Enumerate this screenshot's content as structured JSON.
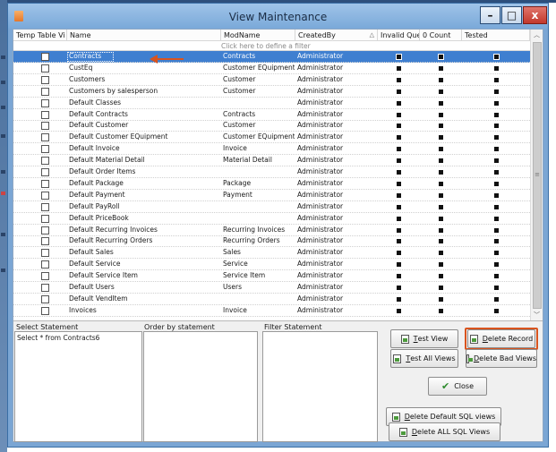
{
  "window": {
    "title": "View Maintenance",
    "min_label": "–",
    "max_label": "□",
    "close_label": "x"
  },
  "columns": [
    "Temp Table Vi",
    "Name",
    "ModName",
    "CreatedBy",
    "Invalid Quer",
    "0 Count",
    "Tested"
  ],
  "filter_prompt": "Click here to define a filter",
  "rows": [
    {
      "name": "Contracts",
      "mod": "Contracts",
      "by": "Administrator",
      "selected": true
    },
    {
      "name": "CustEq",
      "mod": "Customer EQuipment",
      "by": "Administrator"
    },
    {
      "name": "Customers",
      "mod": "Customer",
      "by": "Administrator"
    },
    {
      "name": "Customers by salesperson",
      "mod": "Customer",
      "by": "Administrator"
    },
    {
      "name": "Default Classes",
      "mod": "",
      "by": "Administrator"
    },
    {
      "name": "Default Contracts",
      "mod": "Contracts",
      "by": "Administrator"
    },
    {
      "name": "Default Customer",
      "mod": "Customer",
      "by": "Administrator"
    },
    {
      "name": "Default Customer EQuipment",
      "mod": "Customer EQuipment",
      "by": "Administrator"
    },
    {
      "name": "Default Invoice",
      "mod": "Invoice",
      "by": "Administrator"
    },
    {
      "name": "Default Material Detail",
      "mod": "Material Detail",
      "by": "Administrator"
    },
    {
      "name": "Default Order Items",
      "mod": "",
      "by": "Administrator"
    },
    {
      "name": "Default Package",
      "mod": "Package",
      "by": "Administrator"
    },
    {
      "name": "Default Payment",
      "mod": "Payment",
      "by": "Administrator"
    },
    {
      "name": "Default PayRoll",
      "mod": "",
      "by": "Administrator"
    },
    {
      "name": "Default PriceBook",
      "mod": "",
      "by": "Administrator"
    },
    {
      "name": "Default Recurring Invoices",
      "mod": "Recurring Invoices",
      "by": "Administrator"
    },
    {
      "name": "Default Recurring Orders",
      "mod": "Recurring Orders",
      "by": "Administrator"
    },
    {
      "name": "Default Sales",
      "mod": "Sales",
      "by": "Administrator"
    },
    {
      "name": "Default Service",
      "mod": "Service",
      "by": "Administrator"
    },
    {
      "name": "Default Service Item",
      "mod": "Service Item",
      "by": "Administrator"
    },
    {
      "name": "Default Users",
      "mod": "Users",
      "by": "Administrator"
    },
    {
      "name": "Default VendItem",
      "mod": "",
      "by": "Administrator"
    },
    {
      "name": "Invoices",
      "mod": "Invoice",
      "by": "Administrator"
    }
  ],
  "statements": {
    "select_label": "Select Statement",
    "select_value": "Select * from Contracts6",
    "order_label": "Order by statement",
    "filter_label": "Filter Statement"
  },
  "buttons": {
    "test_view": {
      "hot": "T",
      "rest": "est View"
    },
    "delete_record": {
      "hot": "D",
      "rest": "elete Record"
    },
    "test_all": {
      "hot": "T",
      "rest": "est All Views"
    },
    "delete_bad": {
      "hot": "D",
      "rest": "elete Bad Views"
    },
    "close": "Close",
    "delete_default": {
      "hot": "D",
      "rest": "elete  Default SQL views"
    },
    "delete_all": {
      "hot": "D",
      "rest": "elete  ALL SQL Views"
    }
  },
  "colors": {
    "selection": "#3f7fd0",
    "highlight": "#d9541e",
    "arrow": "#d9541e"
  }
}
